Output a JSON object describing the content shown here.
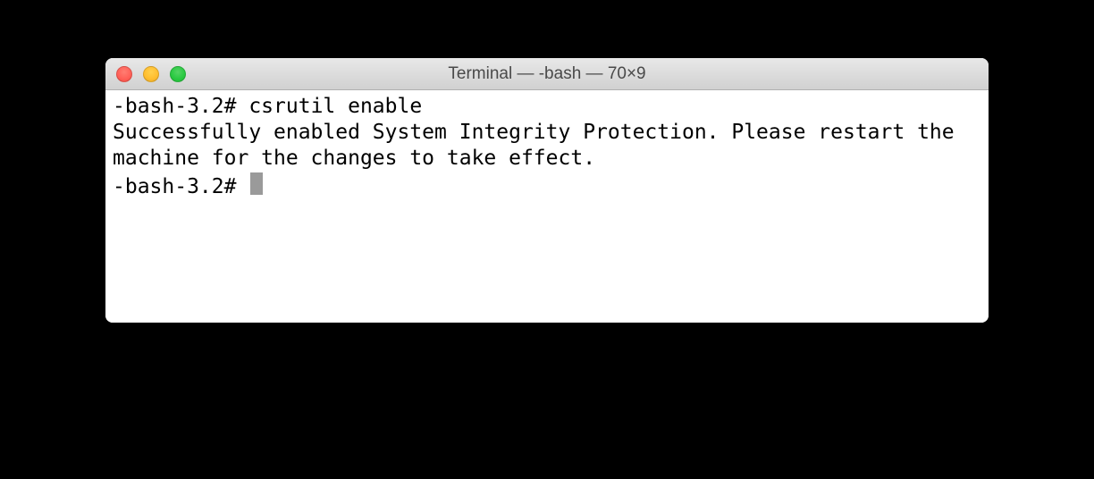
{
  "window": {
    "title": "Terminal — -bash — 70×9"
  },
  "terminal": {
    "lines": [
      {
        "prompt": "-bash-3.2# ",
        "command": "csrutil enable"
      }
    ],
    "output": "Successfully enabled System Integrity Protection. Please restart the machine for the changes to take effect.",
    "current_prompt": "-bash-3.2# "
  },
  "colors": {
    "close": "#ff5f57",
    "minimize": "#ffbd2e",
    "maximize": "#28c940",
    "background": "#000000",
    "terminal_bg": "#ffffff",
    "text": "#000000"
  }
}
